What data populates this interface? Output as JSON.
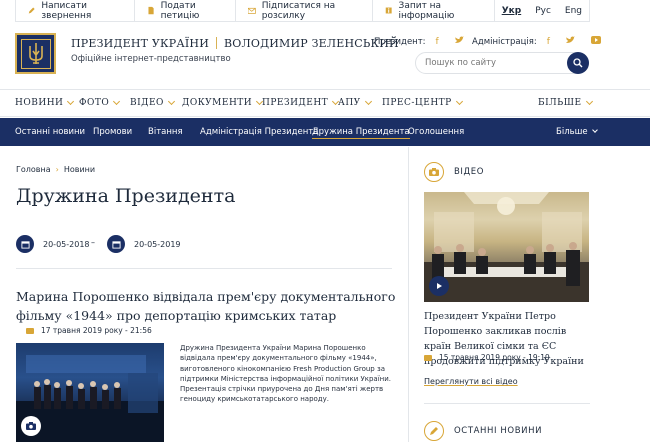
{
  "util": {
    "appeal": "Написати звернення",
    "petition": "Подати петицію",
    "subscribe": "Підписатися на розсилку",
    "request": "Запит на інформацію",
    "langs": [
      "Укр",
      "Рус",
      "Eng"
    ]
  },
  "brand": {
    "title_left": "ПРЕЗИДЕНТ УКРАЇНИ",
    "title_right": "ВОЛОДИМИР ЗЕЛЕНСЬКИЙ",
    "subtitle": "Офіційне інтернет-представництво"
  },
  "social": {
    "president_label": "Президент:",
    "admin_label": "Адміністрація:",
    "facebook_glyph": "f",
    "twitter_glyph": "𝕥",
    "youtube_glyph": "▶"
  },
  "search": {
    "placeholder": "Пошук по сайту"
  },
  "mainnav": [
    "НОВИНИ",
    "ФОТО",
    "ВІДЕО",
    "ДОКУМЕНТИ",
    "ПРЕЗИДЕНТ",
    "АПУ",
    "ПРЕС-ЦЕНТР",
    "БІЛЬШЕ"
  ],
  "subnav": [
    "Останні новини",
    "Промови",
    "Вітання",
    "Адміністрація Президента",
    "Дружина Президента",
    "Оголошення",
    "Більше"
  ],
  "breadcrumb": {
    "home": "Головна",
    "news": "Новини"
  },
  "page_title": "Дружина Президента",
  "dates": {
    "from": "20-05-2018",
    "dash": "–",
    "to": "20-05-2019"
  },
  "article": {
    "title": "Марина Порошенко відвідала прем'єру документального фільму «1944» про депортацію кримських татар",
    "date": "17 травня 2019 року - 21:56",
    "text": "Дружина Президента України Марина Порошенко відвідала прем'єру документального фільму «1944», виготовленого кінокомпанією Fresh Production Group за підтримки Міністерства інформаційної політики України. Презентація стрічки приурочена до Дня пам'яті жертв геноциду кримськотатарського народу."
  },
  "video": {
    "section": "ВІДЕО",
    "title": "Президент України Петро Порошенко закликав послів країн Великої сімки та ЄС продовжити підтримку України",
    "date": "15 травня 2019 року - 19:19",
    "all": "Переглянути всі відео"
  },
  "latest": {
    "section": "ОСТАННІ НОВИНИ"
  },
  "colors": {
    "navy": "#1b2f64",
    "gold": "#d8a637"
  }
}
